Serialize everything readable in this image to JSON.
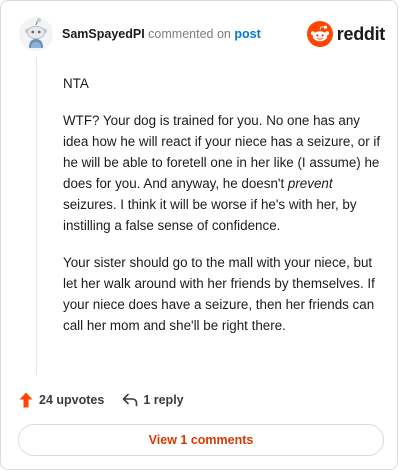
{
  "header": {
    "username": "SamSpayedPI",
    "action_text": "commented on",
    "post_link": "post",
    "logo_text": "reddit"
  },
  "comment": {
    "p1": "NTA",
    "p2_before": "WTF? Your dog is trained for you. No one has any idea how he will react if your niece has a seizure, or if he will be able to foretell one in her like (I assume) he does for you. And anyway, he doesn't ",
    "p2_em": "prevent",
    "p2_after": " seizures. I think it will be worse if he's with her, by instilling a false sense of confidence.",
    "p3": "Your sister should go to the mall with your niece, but let her walk around with her friends by themselves. If your niece does have a seizure, then her friends can call her mom and she'll be right there."
  },
  "actions": {
    "upvotes": "24 upvotes",
    "replies": "1 reply"
  },
  "view_comments_label": "View 1 comments",
  "colors": {
    "upvote": "#ff4500",
    "brand": "#ff4500",
    "link": "#0079d3",
    "button_text": "#d93a00"
  },
  "icons": [
    "snoo-avatar-icon",
    "reddit-logo-icon",
    "upvote-arrow-icon",
    "reply-arrow-icon"
  ]
}
